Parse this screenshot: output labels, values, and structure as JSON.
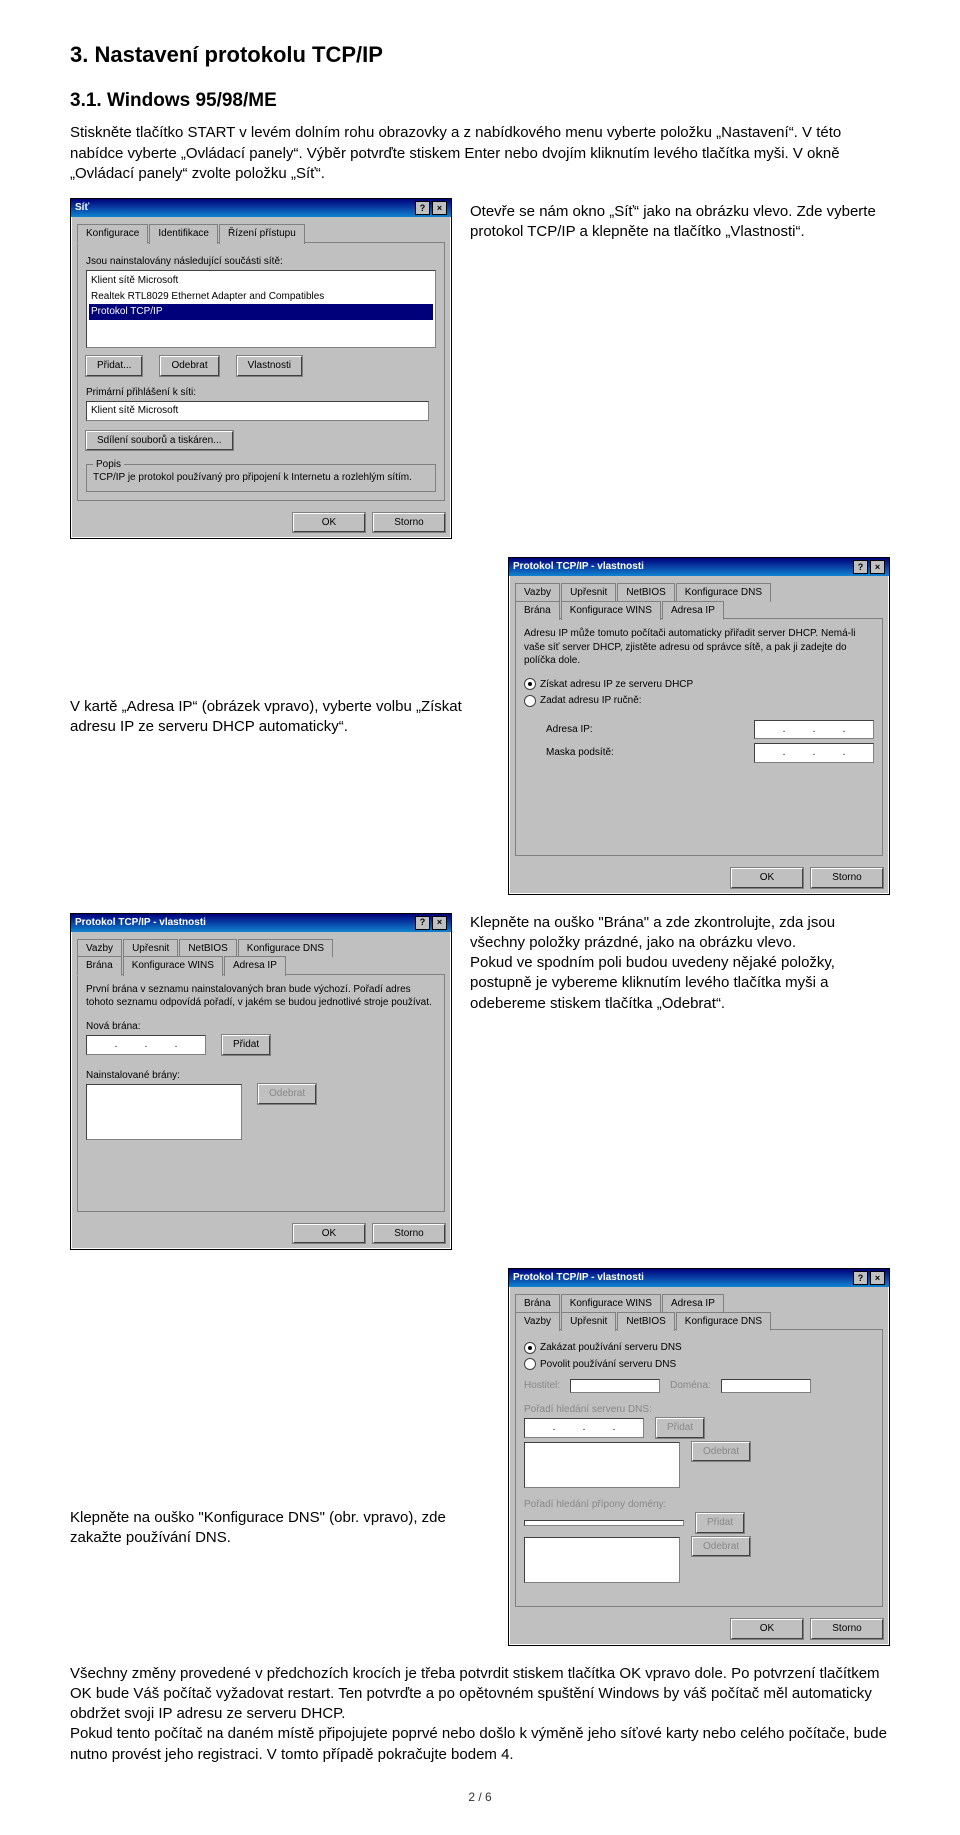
{
  "headings": {
    "section": "3. Nastavení protokolu TCP/IP",
    "sub1": "3.1. Windows 95/98/ME"
  },
  "paras": {
    "p1": "Stiskněte tlačítko START v levém dolním rohu obrazovky a z nabídkového menu vyberte položku „Nastavení“. V této nabídce vyberte „Ovládací panely“. Výběr potvrďte stiskem Enter nebo dvojím kliknutím levého tlačítka myši. V okně „Ovládací panely“ zvolte  položku „Síť“.",
    "p2": "Otevře se nám okno „Síť“ jako na obrázku vlevo. Zde vyberte protokol TCP/IP a klepněte na tlačítko „Vlastnosti“.",
    "p3": "V kartě „Adresa IP“ (obrázek vpravo), vyberte  volbu „Získat adresu IP ze serveru DHCP automaticky“.",
    "p4": "Klepněte na ouško \"Brána\" a zde zkontrolujte, zda jsou  všechny položky prázdné, jako na obrázku vlevo.\nPokud ve spodním poli budou uvedeny nějaké položky, postupně je vybereme kliknutím levého tlačítka myši a odebereme stiskem tlačítka „Odebrat“.",
    "p5": "Klepněte na ouško \"Konfigurace DNS\" (obr. vpravo),  zde zakažte používání DNS.",
    "p6": "Všechny změny provedené v předchozích krocích je třeba potvrdit stiskem tlačítka OK vpravo dole. Po potvrzení tlačítkem OK bude Váš počítač vyžadovat restart. Ten potvrďte a po opětovném spuštění Windows by váš počítač měl automaticky obdržet svoji IP adresu ze serveru DHCP.\nPokud tento počítač na daném místě připojujete poprvé nebo došlo k výměně jeho síťové karty nebo celého počítače, bude nutno provést jeho registraci. V tomto případě pokračujte bodem 4."
  },
  "win_sit": {
    "title": "Síť",
    "tabs": [
      "Konfigurace",
      "Identifikace",
      "Řízení přístupu"
    ],
    "list_label": "Jsou nainstalovány následující součásti sítě:",
    "items": [
      "Klient sítě Microsoft",
      "Realtek RTL8029 Ethernet Adapter and Compatibles",
      "Protokol TCP/IP"
    ],
    "btns": {
      "add": "Přidat...",
      "remove": "Odebrat",
      "props": "Vlastnosti"
    },
    "login_label": "Primární přihlášení k síti:",
    "login_value": "Klient sítě Microsoft",
    "share_btn": "Sdílení souborů a tiskáren...",
    "desc_title": "Popis",
    "desc_text": "TCP/IP je protokol používaný pro připojení k Internetu a rozlehlým sítím.",
    "ok": "OK",
    "cancel": "Storno"
  },
  "win_ip": {
    "title": "Protokol TCP/IP - vlastnosti",
    "tabs_top": [
      "Vazby",
      "Upřesnit",
      "NetBIOS",
      "Konfigurace DNS"
    ],
    "tabs_bot": [
      "Brána",
      "Konfigurace WINS",
      "Adresa IP"
    ],
    "info": "Adresu IP může tomuto počítači automaticky přiřadit server DHCP. Nemá-li vaše síť server DHCP, zjistěte adresu od správce sítě, a pak ji zadejte do políčka dole.",
    "radio1": "Získat adresu IP ze serveru DHCP",
    "radio2": "Zadat adresu IP ručně:",
    "field1": "Adresa IP:",
    "field2": "Maska podsítě:",
    "ok": "OK",
    "cancel": "Storno"
  },
  "win_gw": {
    "title": "Protokol TCP/IP - vlastnosti",
    "tabs_top": [
      "Vazby",
      "Upřesnit",
      "NetBIOS",
      "Konfigurace DNS"
    ],
    "tabs_bot": [
      "Brána",
      "Konfigurace WINS",
      "Adresa IP"
    ],
    "info": "První brána v seznamu nainstalovaných bran bude výchozí. Pořadí adres tohoto seznamu odpovídá pořadí, v jakém se budou jednotlivé stroje používat.",
    "new_label": "Nová brána:",
    "add": "Přidat",
    "inst_label": "Nainstalované brány:",
    "remove": "Odebrat",
    "ok": "OK",
    "cancel": "Storno"
  },
  "win_dns": {
    "title": "Protokol TCP/IP - vlastnosti",
    "tabs_top": [
      "Brána",
      "Konfigurace WINS",
      "Adresa IP"
    ],
    "tabs_bot": [
      "Vazby",
      "Upřesnit",
      "NetBIOS",
      "Konfigurace DNS"
    ],
    "radio1": "Zakázat používání serveru DNS",
    "radio2": "Povolit používání serveru DNS",
    "host": "Hostitel:",
    "domain": "Doména:",
    "order1": "Pořadí hledání serveru DNS:",
    "add": "Přidat",
    "remove": "Odebrat",
    "order2": "Pořadí hledání přípony domény:",
    "ok": "OK",
    "cancel": "Storno"
  },
  "page_number": "2 / 6"
}
